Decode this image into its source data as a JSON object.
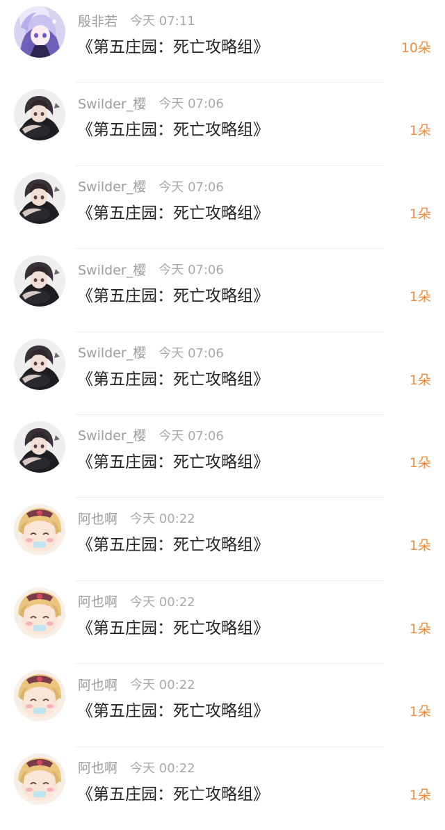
{
  "colors": {
    "username": "#9b9b9b",
    "time": "#a8a8a8",
    "title": "#222222",
    "count": "#f08a3c",
    "divider": "#f0f0f0"
  },
  "rows": [
    {
      "avatar": "avatar-purple-girl",
      "username": "殷非若",
      "time": "今天 07:11",
      "title": "《第五庄园：死亡攻略组》",
      "count": "10朵"
    },
    {
      "avatar": "avatar-dark-boy",
      "username": "Swilder_樱",
      "time": "今天 07:06",
      "title": "《第五庄园：死亡攻略组》",
      "count": "1朵"
    },
    {
      "avatar": "avatar-dark-boy",
      "username": "Swilder_樱",
      "time": "今天 07:06",
      "title": "《第五庄园：死亡攻略组》",
      "count": "1朵"
    },
    {
      "avatar": "avatar-dark-boy",
      "username": "Swilder_樱",
      "time": "今天 07:06",
      "title": "《第五庄园：死亡攻略组》",
      "count": "1朵"
    },
    {
      "avatar": "avatar-dark-boy",
      "username": "Swilder_樱",
      "time": "今天 07:06",
      "title": "《第五庄园：死亡攻略组》",
      "count": "1朵"
    },
    {
      "avatar": "avatar-dark-boy",
      "username": "Swilder_樱",
      "time": "今天 07:06",
      "title": "《第五庄园：死亡攻略组》",
      "count": "1朵"
    },
    {
      "avatar": "avatar-blonde-chibi",
      "username": "阿也啊",
      "time": "今天 00:22",
      "title": "《第五庄园：死亡攻略组》",
      "count": "1朵"
    },
    {
      "avatar": "avatar-blonde-chibi",
      "username": "阿也啊",
      "time": "今天 00:22",
      "title": "《第五庄园：死亡攻略组》",
      "count": "1朵"
    },
    {
      "avatar": "avatar-blonde-chibi",
      "username": "阿也啊",
      "time": "今天 00:22",
      "title": "《第五庄园：死亡攻略组》",
      "count": "1朵"
    },
    {
      "avatar": "avatar-blonde-chibi",
      "username": "阿也啊",
      "time": "今天 00:22",
      "title": "《第五庄园：死亡攻略组》",
      "count": "1朵"
    }
  ]
}
